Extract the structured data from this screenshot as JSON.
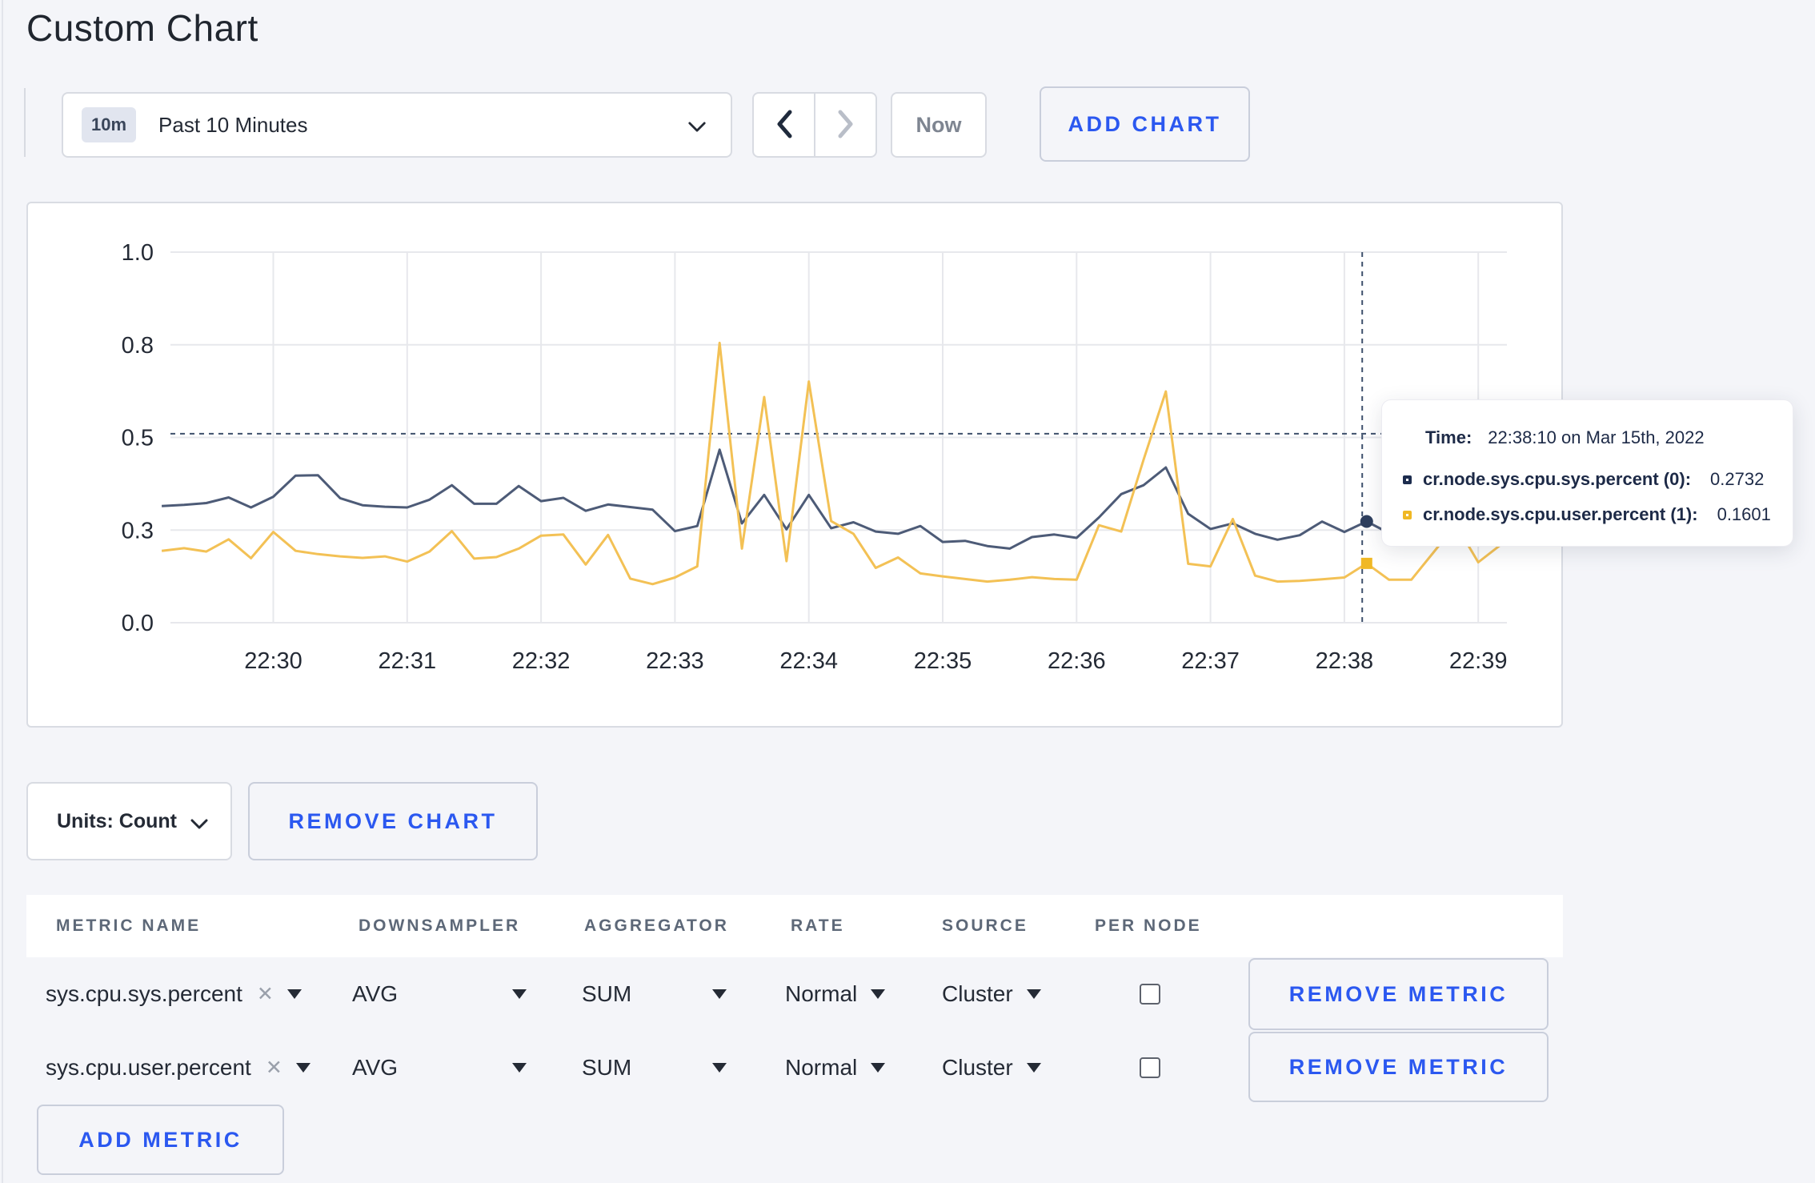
{
  "page": {
    "title": "Custom Chart"
  },
  "toolbar": {
    "time_badge": "10m",
    "time_label": "Past 10 Minutes",
    "now_label": "Now",
    "add_chart_label": "ADD CHART"
  },
  "chart_data": {
    "type": "line",
    "title": "",
    "xlabel": "",
    "ylabel": "",
    "ylim": [
      0,
      1
    ],
    "grid": true,
    "x_start": "22:29:10",
    "x_interval_seconds": 10,
    "x_ticks": [
      "22:30",
      "22:31",
      "22:32",
      "22:33",
      "22:34",
      "22:35",
      "22:36",
      "22:37",
      "22:38",
      "22:39"
    ],
    "y_ticks": [
      {
        "value": 0,
        "label": "0.0"
      },
      {
        "value": 0.25,
        "label": "0.3"
      },
      {
        "value": 0.5,
        "label": "0.5"
      },
      {
        "value": 0.75,
        "label": "0.8"
      },
      {
        "value": 1,
        "label": "1.0"
      }
    ],
    "series": [
      {
        "name": "cr.node.sys.cpu.sys.percent",
        "color": "#4d5b77",
        "point_color": "#2e3f5e",
        "point_shape": "circle",
        "values": [
          0.315,
          0.318,
          0.323,
          0.338,
          0.311,
          0.34,
          0.397,
          0.398,
          0.336,
          0.317,
          0.313,
          0.311,
          0.332,
          0.371,
          0.321,
          0.321,
          0.369,
          0.328,
          0.337,
          0.302,
          0.319,
          0.312,
          0.305,
          0.247,
          0.261,
          0.467,
          0.268,
          0.345,
          0.252,
          0.345,
          0.255,
          0.271,
          0.246,
          0.24,
          0.261,
          0.218,
          0.221,
          0.207,
          0.2,
          0.231,
          0.238,
          0.229,
          0.284,
          0.347,
          0.371,
          0.419,
          0.294,
          0.253,
          0.268,
          0.24,
          0.224,
          0.236,
          0.273,
          0.245,
          0.2732,
          0.242,
          0.238,
          0.255,
          0.27,
          0.251,
          0.26
        ]
      },
      {
        "name": "cr.node.sys.cpu.user.percent",
        "color": "#f3c155",
        "point_color": "#f0b824",
        "point_shape": "square",
        "values": [
          0.194,
          0.201,
          0.192,
          0.225,
          0.174,
          0.245,
          0.194,
          0.185,
          0.179,
          0.175,
          0.179,
          0.165,
          0.192,
          0.247,
          0.173,
          0.177,
          0.2,
          0.235,
          0.238,
          0.157,
          0.237,
          0.119,
          0.104,
          0.122,
          0.152,
          0.755,
          0.2,
          0.609,
          0.166,
          0.651,
          0.274,
          0.24,
          0.148,
          0.176,
          0.133,
          0.125,
          0.118,
          0.111,
          0.116,
          0.123,
          0.118,
          0.116,
          0.263,
          0.246,
          0.44,
          0.624,
          0.159,
          0.152,
          0.28,
          0.127,
          0.111,
          0.113,
          0.117,
          0.122,
          0.1601,
          0.116,
          0.116,
          0.19,
          0.265,
          0.163,
          0.21
        ]
      }
    ],
    "hover": {
      "point_index": 54,
      "mouse_time": "22:38:08",
      "mouse_value": 0.51
    },
    "legend_position": "tooltip"
  },
  "tooltip": {
    "time_label": "Time:",
    "time_value": "22:38:10 on Mar 15th, 2022",
    "rows": [
      {
        "name": "cr.node.sys.cpu.sys.percent (0):",
        "value": "0.2732",
        "color": "#1c2c4e"
      },
      {
        "name": "cr.node.sys.cpu.user.percent (1):",
        "value": "0.1601",
        "color": "#f0b824"
      }
    ]
  },
  "chart_footer": {
    "units_label": "Units: Count",
    "remove_chart_label": "REMOVE CHART"
  },
  "table": {
    "headers": [
      "METRIC NAME",
      "DOWNSAMPLER",
      "AGGREGATOR",
      "RATE",
      "SOURCE",
      "PER NODE"
    ],
    "rows": [
      {
        "metric_name": "sys.cpu.sys.percent",
        "downsampler": "AVG",
        "aggregator": "SUM",
        "rate": "Normal",
        "source": "Cluster",
        "per_node": false,
        "remove_label": "REMOVE METRIC"
      },
      {
        "metric_name": "sys.cpu.user.percent",
        "downsampler": "AVG",
        "aggregator": "SUM",
        "rate": "Normal",
        "source": "Cluster",
        "per_node": false,
        "remove_label": "REMOVE METRIC"
      }
    ],
    "add_metric_label": "ADD METRIC"
  }
}
